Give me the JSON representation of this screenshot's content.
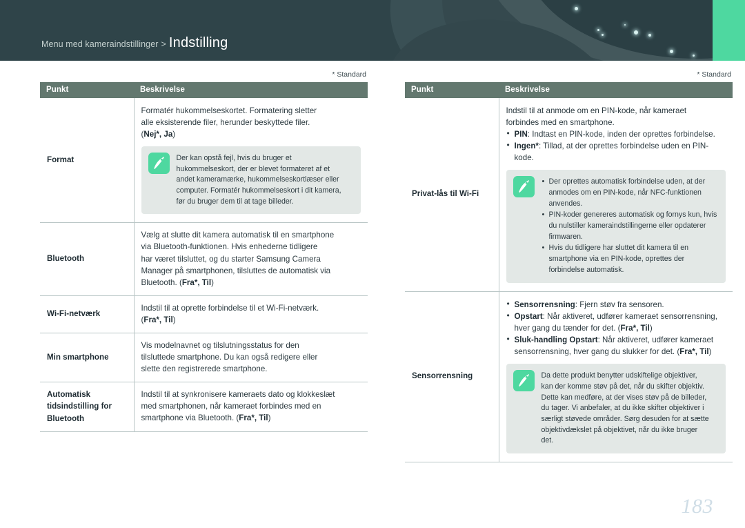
{
  "header": {
    "breadcrumb_prefix": "Menu med kameraindstillinger",
    "breadcrumb_separator": ">",
    "title": "Indstilling",
    "accent_color": "#4ed8a0",
    "background_color": "#2f4449"
  },
  "page_number": "183",
  "left_table": {
    "standard_note": "* Standard",
    "columns": [
      "Punkt",
      "Beskrivelse"
    ],
    "rows": [
      {
        "item": "Format",
        "desc_lines": [
          "Formatér hukommelseskortet. Formatering sletter",
          "alle eksisterende filer, herunder beskyttede filer."
        ],
        "options_prefix": "(",
        "options": "Nej*, Ja",
        "options_suffix": ")",
        "note": {
          "icon": "pen-nib-icon",
          "lines": [
            "Der kan opstå fejl, hvis du bruger et",
            "hukommelseskort, der er blevet formateret af et",
            "andet kameramærke, hukommelseskortlæser eller",
            "computer. Formatér hukommelseskort i dit kamera,",
            "før du bruger dem til at tage billeder."
          ]
        }
      },
      {
        "item": "Bluetooth",
        "desc_lines": [
          "Vælg at slutte dit kamera automatisk til en smartphone",
          "via Bluetooth-funktionen. Hvis enhederne tidligere",
          "har været tilsluttet, og du starter Samsung Camera",
          "Manager på smartphonen, tilsluttes de automatisk via",
          "Bluetooth. "
        ],
        "options_prefix": "(",
        "options": "Fra*, Til",
        "options_suffix": ")"
      },
      {
        "item": "Wi-Fi-netværk",
        "desc_lines": [
          "Indstil til at oprette forbindelse til et Wi-Fi-netværk."
        ],
        "options_prefix": "(",
        "options": "Fra*, Til",
        "options_suffix": ")"
      },
      {
        "item": "Min smartphone",
        "desc_lines": [
          "Vis modelnavnet og tilslutningsstatus for den",
          "tilsluttede smartphone. Du kan også redigere eller",
          "slette den registrerede smartphone."
        ]
      },
      {
        "item": "Automatisk tidsindstilling for Bluetooth",
        "desc_lines": [
          "Indstil til at synkronisere kameraets dato og klokkeslæt",
          "med smartphonen, når kameraet forbindes med en",
          "smartphone via Bluetooth. "
        ],
        "options_prefix": "(",
        "options": "Fra*, Til",
        "options_suffix": ")"
      }
    ]
  },
  "right_table": {
    "standard_note": "* Standard",
    "columns": [
      "Punkt",
      "Beskrivelse"
    ],
    "rows": [
      {
        "item": "Privat-lås til Wi-Fi",
        "desc_lines": [
          "Indstil til at anmode om en PIN-kode, når kameraet",
          "forbindes med en smartphone."
        ],
        "bullets": [
          {
            "bold": "PIN",
            "text": ": Indtast en PIN-kode, inden der oprettes forbindelse."
          },
          {
            "bold": "Ingen*",
            "text": ": Tillad, at der oprettes forbindelse uden en PIN-kode."
          }
        ],
        "note": {
          "icon": "pen-nib-icon",
          "bullets": [
            "Der oprettes automatisk forbindelse uden, at der anmodes om en PIN-kode, når NFC-funktionen anvendes.",
            "PIN-koder genereres automatisk og fornys kun, hvis du nulstiller kameraindstillingerne eller opdaterer firmwaren.",
            "Hvis du tidligere har sluttet dit kamera til en smartphone via en PIN-kode, oprettes der forbindelse automatisk."
          ]
        }
      },
      {
        "item": "Sensorrensning",
        "bullets": [
          {
            "bold": "Sensorrensning",
            "text": ": Fjern støv fra sensoren."
          },
          {
            "bold": "Opstart",
            "text": ": Når aktiveret, udfører kameraet sensorrensning, hver gang du tænder for det. (",
            "options": "Fra*, Til",
            "suffix": ")"
          },
          {
            "bold": "Sluk-handling Opstart",
            "text": ": Når aktiveret, udfører kameraet sensorrensning, hver gang du slukker for det. (",
            "options": "Fra*, Til",
            "suffix": ")"
          }
        ],
        "note": {
          "icon": "pen-nib-icon",
          "lines": [
            "Da dette produkt benytter udskiftelige objektiver,",
            "kan der komme støv på det, når du skifter objektiv.",
            "Dette kan medføre, at der vises støv på de billeder,",
            "du tager. Vi anbefaler, at du ikke skifter objektiver i",
            "særligt støvede områder. Sørg desuden for at sætte",
            "objektivdækslet på objektivet, når du ikke bruger",
            "det."
          ]
        }
      }
    ]
  }
}
